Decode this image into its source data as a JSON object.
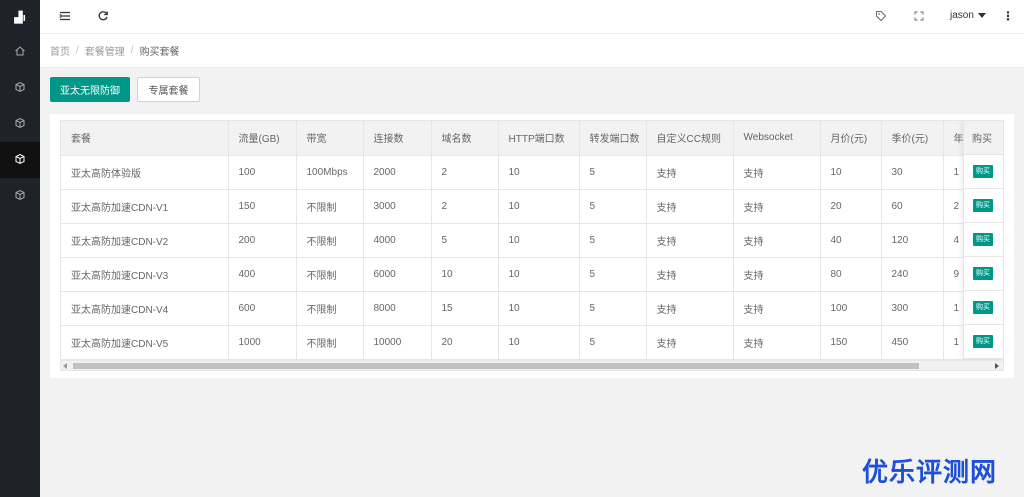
{
  "sidebar": {
    "logo": "▟ı",
    "items": [
      {
        "icon": "home-icon"
      },
      {
        "icon": "cube-icon"
      },
      {
        "icon": "cube-icon"
      },
      {
        "icon": "cube-icon",
        "active": true
      },
      {
        "icon": "cube-icon"
      }
    ]
  },
  "header": {
    "user": "jason"
  },
  "breadcrumb": {
    "items": [
      "首页",
      "套餐管理",
      "购买套餐"
    ],
    "separator": "/"
  },
  "buttons": {
    "primary": "亚太无限防御",
    "secondary": "专属套餐"
  },
  "table": {
    "columns": [
      "套餐",
      "流量(GB)",
      "带宽",
      "连接数",
      "域名数",
      "HTTP端口数",
      "转发端口数",
      "自定义CC规则",
      "Websocket",
      "月价(元)",
      "季价(元)",
      "年"
    ],
    "buy_column": "购买",
    "buy_label": "购买",
    "rows": [
      [
        "亚太高防体验版",
        "100",
        "100Mbps",
        "2000",
        "2",
        "10",
        "5",
        "支持",
        "支持",
        "10",
        "30",
        "1"
      ],
      [
        "亚太高防加速CDN-V1",
        "150",
        "不限制",
        "3000",
        "2",
        "10",
        "5",
        "支持",
        "支持",
        "20",
        "60",
        "2"
      ],
      [
        "亚太高防加速CDN-V2",
        "200",
        "不限制",
        "4000",
        "5",
        "10",
        "5",
        "支持",
        "支持",
        "40",
        "120",
        "4"
      ],
      [
        "亚太高防加速CDN-V3",
        "400",
        "不限制",
        "6000",
        "10",
        "10",
        "5",
        "支持",
        "支持",
        "80",
        "240",
        "9"
      ],
      [
        "亚太高防加速CDN-V4",
        "600",
        "不限制",
        "8000",
        "15",
        "10",
        "5",
        "支持",
        "支持",
        "100",
        "300",
        "1"
      ],
      [
        "亚太高防加速CDN-V5",
        "1000",
        "不限制",
        "10000",
        "20",
        "10",
        "5",
        "支持",
        "支持",
        "150",
        "450",
        "1"
      ]
    ]
  },
  "watermark": "优乐评测网",
  "colors": {
    "sidebar_bg": "#20222a",
    "accent": "#009688",
    "watermark": "#1e4fd8"
  }
}
